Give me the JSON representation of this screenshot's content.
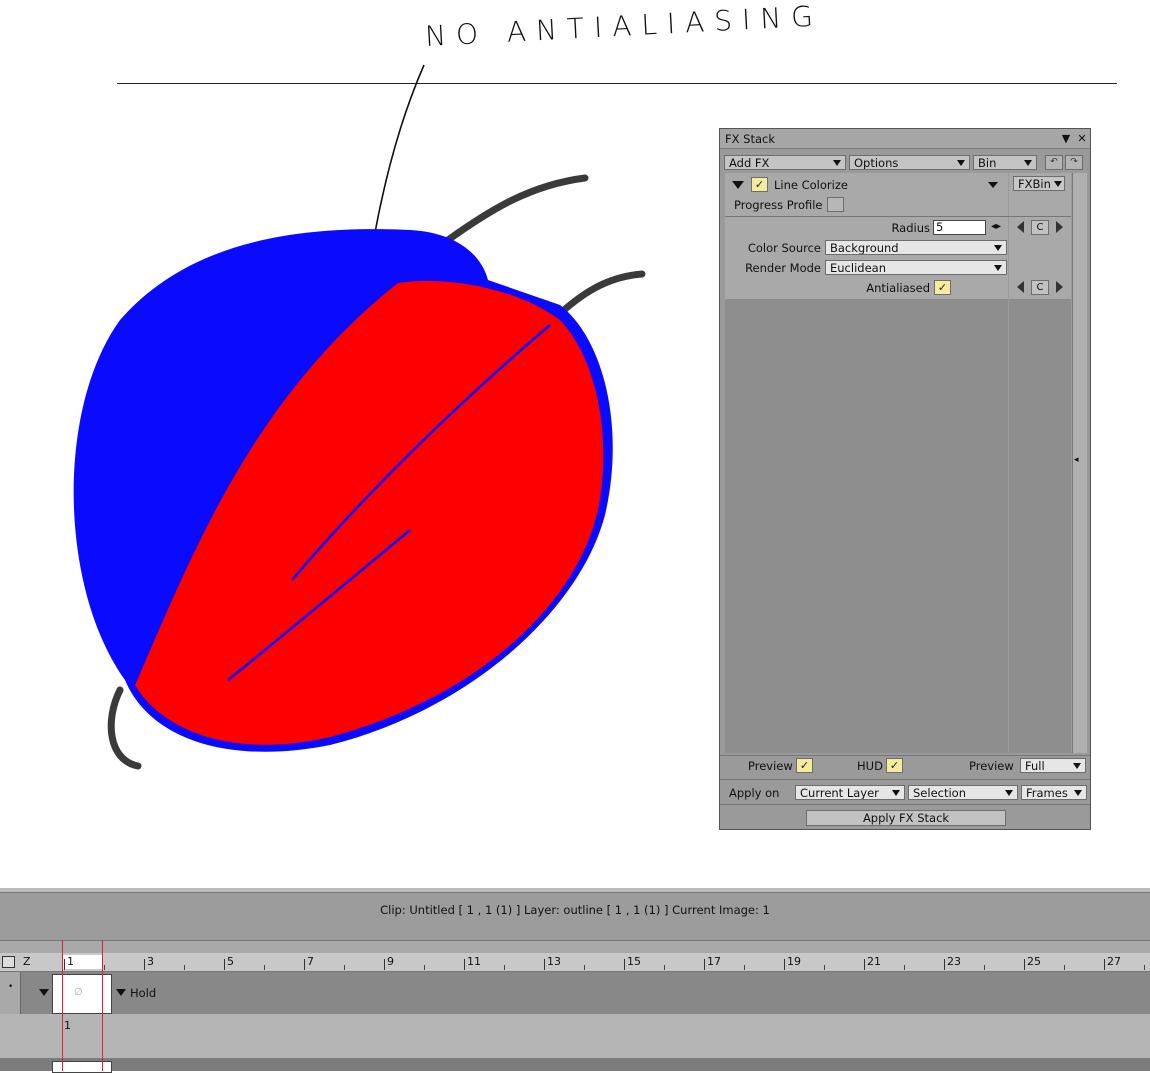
{
  "annotation": {
    "text": "NO ANTIALIASING"
  },
  "fx_panel": {
    "title": "FX Stack",
    "toolbar": {
      "add_fx": "Add FX",
      "options": "Options",
      "bin": "Bin"
    },
    "effect": {
      "name": "Line Colorize",
      "fxbin": "FXBin",
      "progress_profile_label": "Progress Profile",
      "radius_label": "Radius",
      "radius_value": "5",
      "color_source_label": "Color Source",
      "color_source_value": "Background",
      "render_mode_label": "Render Mode",
      "render_mode_value": "Euclidean",
      "antialiased_label": "Antialiased",
      "c_label": "C"
    },
    "footer": {
      "preview_label": "Preview",
      "hud_label": "HUD",
      "preview2_label": "Preview",
      "preview2_value": "Full",
      "apply_on_label": "Apply on",
      "apply_on_value": "Current Layer",
      "selection_value": "Selection",
      "frames_value": "Frames",
      "apply_button": "Apply FX Stack"
    }
  },
  "timeline": {
    "status": "Clip: Untitled [ 1 , 1  (1) ]      Layer: outline [ 1 , 1  (1) ]   Current Image: 1",
    "z_label": "Z",
    "ticks": [
      "1",
      "3",
      "5",
      "7",
      "9",
      "11",
      "13",
      "15",
      "17",
      "19",
      "21",
      "23",
      "25",
      "27"
    ],
    "hold_label": "Hold",
    "frame_number": "1"
  },
  "colors": {
    "blue": "#0a0aff",
    "red": "#ff0000",
    "panel_bg": "#9a9a9a",
    "check_bg": "#f4eb9e"
  }
}
